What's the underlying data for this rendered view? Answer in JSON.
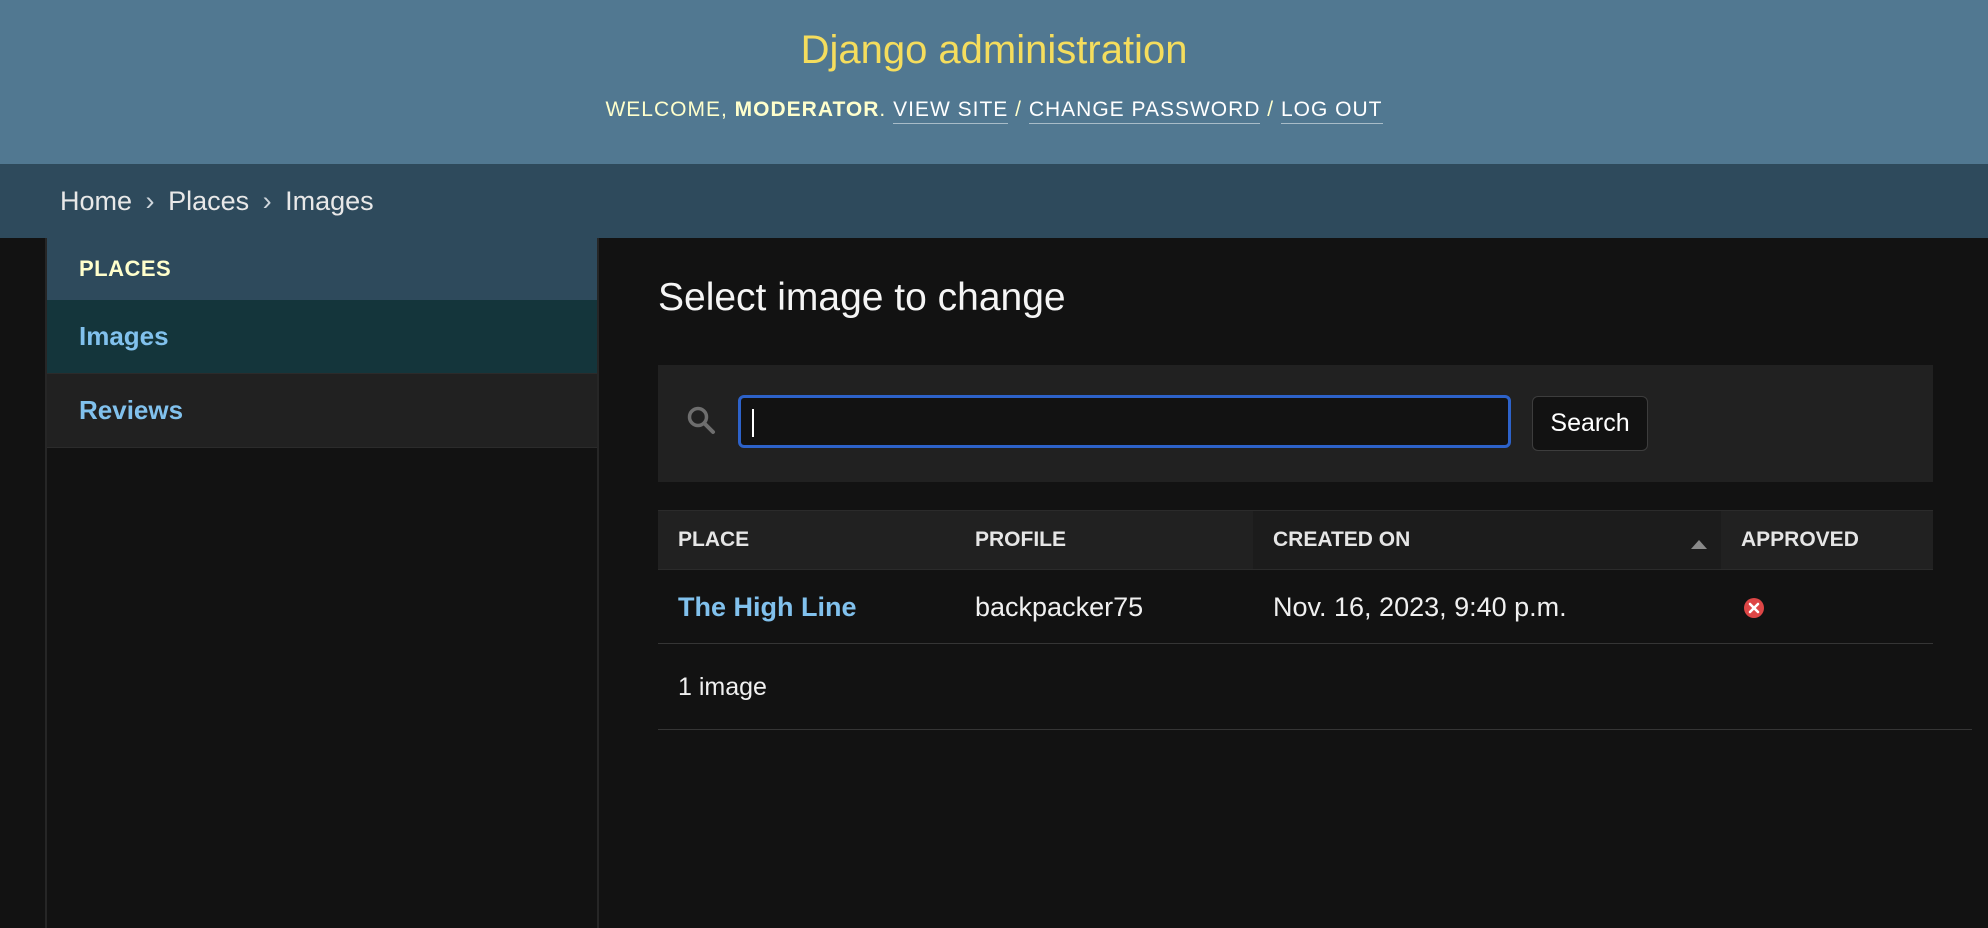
{
  "header": {
    "site_name": "Django administration",
    "welcome": "Welcome,",
    "username": "moderator",
    "view_site": "View site",
    "change_password": "Change password",
    "log_out": "Log out",
    "separator": "/"
  },
  "breadcrumbs": {
    "home": "Home",
    "app": "Places",
    "model": "Images",
    "separator": "›"
  },
  "sidebar": {
    "caption": "Places",
    "items": [
      {
        "label": "Images",
        "current": true
      },
      {
        "label": "Reviews",
        "current": false
      }
    ]
  },
  "main": {
    "title": "Select image to change",
    "search": {
      "value": "",
      "button_label": "Search",
      "icon": "search-icon"
    },
    "table": {
      "columns": [
        "Place",
        "Profile",
        "Created on",
        "Approved"
      ],
      "sorted_column": "Created on",
      "sort_direction": "ascending",
      "rows": [
        {
          "place": "The High Line",
          "profile": "backpacker75",
          "created_on": "Nov. 16, 2023, 9:40 p.m.",
          "approved": false,
          "approved_icon": "icon-no"
        }
      ]
    },
    "paginator": "1 image"
  },
  "colors": {
    "header_bg": "#517891",
    "breadcrumb_bg": "#2e4a5c",
    "site_name": "#f5dd5d",
    "link": "#81c1ed",
    "selected_row": "#14353b",
    "approved_no": "#dd4646",
    "search_focus": "#2d62c9"
  }
}
